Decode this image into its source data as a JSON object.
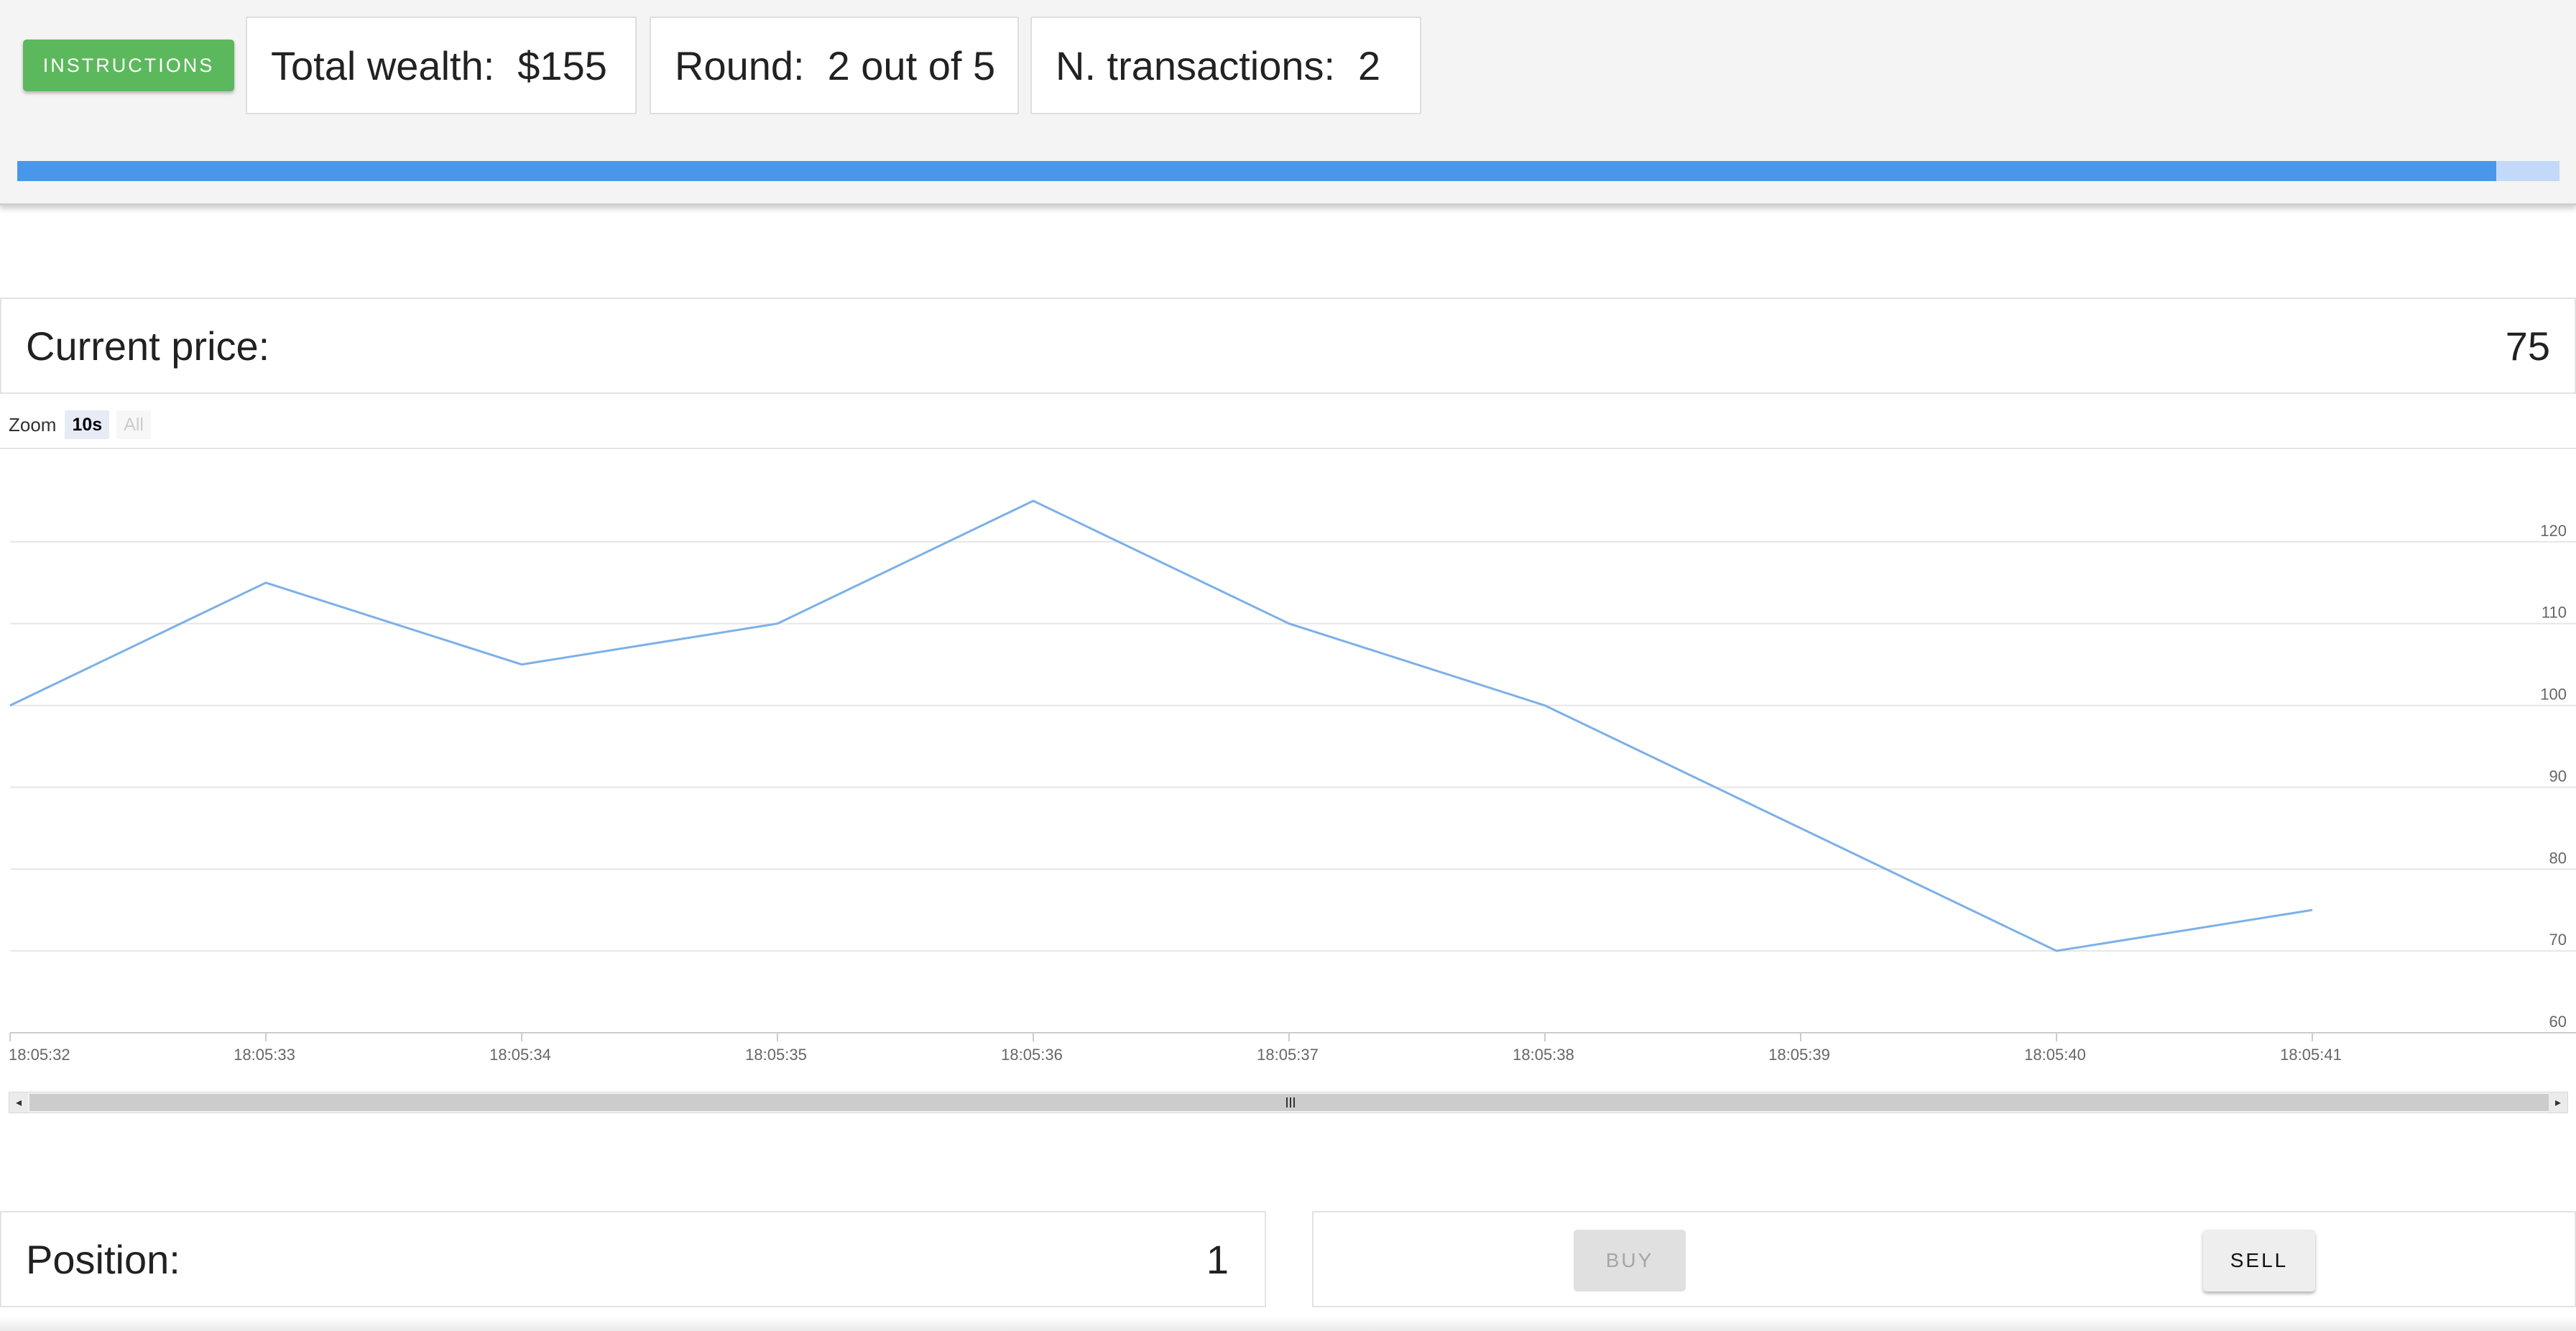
{
  "header": {
    "instructions_label": "INSTRUCTIONS",
    "wealth": {
      "label": "Total wealth:",
      "value": "$155"
    },
    "round": {
      "label": "Round:",
      "value": "2 out of 5"
    },
    "transactions": {
      "label": "N. transactions:",
      "value": "2"
    },
    "progress_fraction": 0.975
  },
  "price_panel": {
    "label": "Current price:",
    "value": "75"
  },
  "zoom": {
    "label": "Zoom",
    "options": [
      "10s",
      "All"
    ],
    "selected": "10s"
  },
  "chart_data": {
    "type": "line",
    "x": [
      "18:05:32",
      "18:05:33",
      "18:05:34",
      "18:05:35",
      "18:05:36",
      "18:05:37",
      "18:05:38",
      "18:05:39",
      "18:05:40",
      "18:05:41"
    ],
    "x_ticks": [
      "18:05:32",
      "18:05:33",
      "18:05:34",
      "18:05:35",
      "18:05:36",
      "18:05:37",
      "18:05:38",
      "18:05:39",
      "18:05:40",
      "18:05:41"
    ],
    "series": [
      {
        "points": [
          [
            "18:05:32.0",
            100
          ],
          [
            "18:05:33.0",
            115
          ],
          [
            "18:05:34.0",
            105
          ],
          [
            "18:05:35.0",
            110
          ],
          [
            "18:05:36.0",
            125
          ],
          [
            "18:05:37.0",
            110
          ],
          [
            "18:05:38.0",
            100
          ],
          [
            "18:05:39.0",
            85
          ],
          [
            "18:05:40.0",
            70
          ],
          [
            "18:05:41.0",
            75
          ]
        ]
      }
    ],
    "y_ticks": [
      60,
      70,
      80,
      90,
      100,
      110,
      120
    ],
    "ylim": [
      60,
      130
    ],
    "y_axis_side": "right",
    "grid": true,
    "line_color": "#7cb0e8"
  },
  "position_panel": {
    "label": "Position:",
    "value": "1"
  },
  "actions": {
    "buy_label": "BUY",
    "sell_label": "SELL"
  }
}
